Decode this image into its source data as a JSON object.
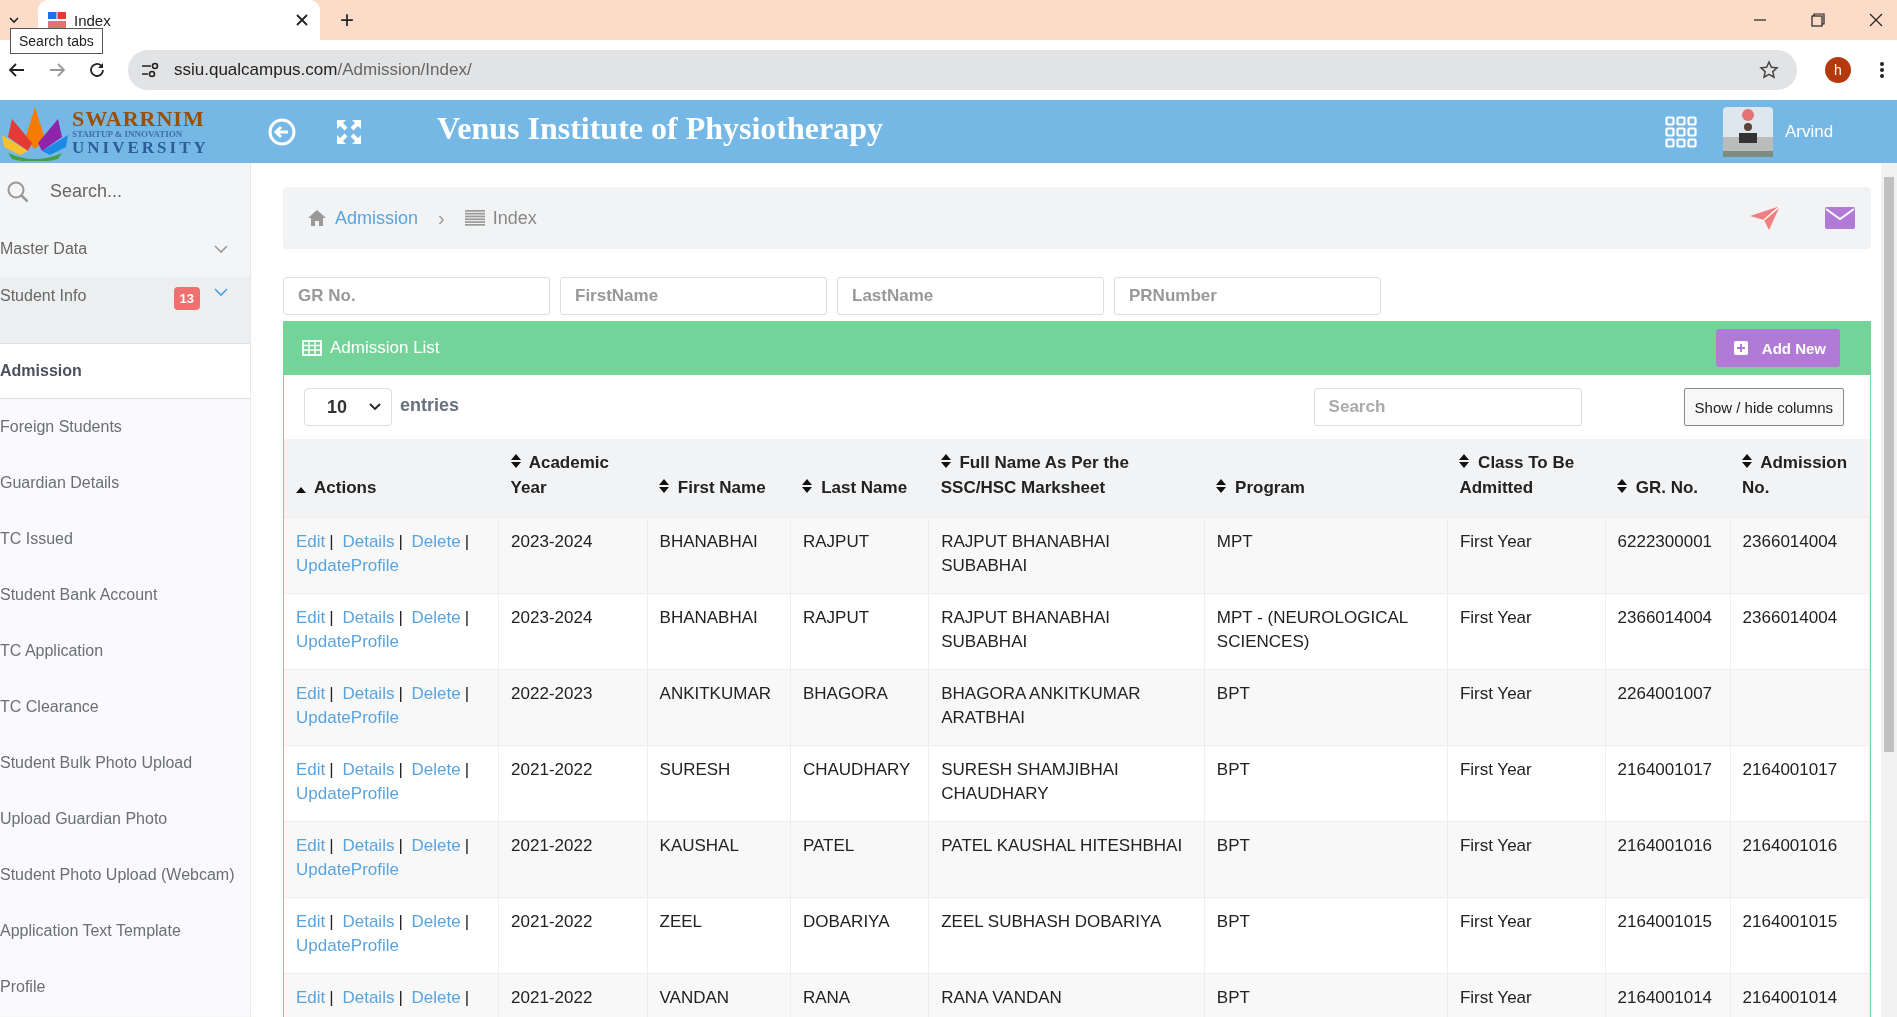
{
  "browser": {
    "tab_title": "Index",
    "tooltip": "Search tabs",
    "new_tab": "+",
    "url_host": "ssiu.qualcampus.com",
    "url_path": "/Admission/Index/",
    "profile_initial": "h"
  },
  "header": {
    "logo_lines": [
      "SWARRNIM",
      "STARTUP & INNOVATION",
      "UNIVERSITY"
    ],
    "title": "Venus Institute of Physiotherapy",
    "user": "Arvind"
  },
  "sidebar": {
    "search_placeholder": "Search...",
    "items": [
      {
        "label": "Master Data",
        "kind": "group",
        "expanded": false
      },
      {
        "label": "Student Info",
        "kind": "group",
        "expanded": true,
        "badge": "13"
      },
      {
        "label": "Admission",
        "kind": "link",
        "selected": true
      },
      {
        "label": "Foreign Students",
        "kind": "link",
        "selected": false
      },
      {
        "label": "Guardian Details",
        "kind": "link",
        "selected": false
      },
      {
        "label": "TC Issued",
        "kind": "link",
        "selected": false
      },
      {
        "label": "Student Bank Account",
        "kind": "link",
        "selected": false
      },
      {
        "label": "TC Application",
        "kind": "link",
        "selected": false
      },
      {
        "label": "TC Clearance",
        "kind": "link",
        "selected": false
      },
      {
        "label": "Student Bulk Photo Upload",
        "kind": "link",
        "selected": false
      },
      {
        "label": "Upload Guardian Photo",
        "kind": "link",
        "selected": false
      },
      {
        "label": "Student Photo Upload (Webcam)",
        "kind": "link",
        "selected": false
      },
      {
        "label": "Application Text Template",
        "kind": "link",
        "selected": false
      },
      {
        "label": "Profile",
        "kind": "link",
        "selected": false
      }
    ]
  },
  "breadcrumb": [
    {
      "label": "Admission",
      "kind": "link"
    },
    {
      "label": "Index",
      "kind": "current"
    }
  ],
  "breadcrumb_separator": "›",
  "filters": [
    {
      "placeholder": "GR No."
    },
    {
      "placeholder": "FirstName"
    },
    {
      "placeholder": "LastName"
    },
    {
      "placeholder": "PRNumber"
    }
  ],
  "panel": {
    "title": "Admission List",
    "add_button": "Add New",
    "page_size": "10",
    "entries_label": "entries",
    "search_placeholder": "Search",
    "columns_button": "Show / hide columns"
  },
  "table": {
    "actions_column": {
      "label": "Actions",
      "sorted": true
    },
    "columns": [
      {
        "label": "Academic Year",
        "sorted": false
      },
      {
        "label": "First Name",
        "sorted": false
      },
      {
        "label": "Last Name",
        "sorted": false
      },
      {
        "label": "Full Name As Per the SSC/HSC Marksheet",
        "sorted": false
      },
      {
        "label": "Program",
        "sorted": false
      },
      {
        "label": "Class To Be Admitted",
        "sorted": false
      },
      {
        "label": "GR. No.",
        "sorted": false
      },
      {
        "label": "Admission No.",
        "sorted": false
      }
    ],
    "rows": [
      {
        "actions": [
          {
            "label": "Edit",
            "sep": "|"
          },
          {
            "label": "Details",
            "sep": "|"
          },
          {
            "label": "Delete",
            "sep": "|"
          },
          {
            "label": "UpdateProfile"
          }
        ],
        "cells": [
          "2023-2024",
          "BHANABHAI",
          "RAJPUT",
          "RAJPUT BHANABHAI SUBABHAI",
          "MPT",
          "First Year",
          "6222300001",
          "2366014004"
        ]
      },
      {
        "actions": [
          {
            "label": "Edit",
            "sep": "|"
          },
          {
            "label": "Details",
            "sep": "|"
          },
          {
            "label": "Delete",
            "sep": "|"
          },
          {
            "label": "UpdateProfile"
          }
        ],
        "cells": [
          "2023-2024",
          "BHANABHAI",
          "RAJPUT",
          "RAJPUT BHANABHAI SUBABHAI",
          "MPT - (NEUROLOGICAL SCIENCES)",
          "First Year",
          "2366014004",
          "2366014004"
        ]
      },
      {
        "actions": [
          {
            "label": "Edit",
            "sep": "|"
          },
          {
            "label": "Details",
            "sep": "|"
          },
          {
            "label": "Delete",
            "sep": "|"
          },
          {
            "label": "UpdateProfile"
          }
        ],
        "cells": [
          "2022-2023",
          "ANKITKUMAR",
          "BHAGORA",
          "BHAGORA ANKITKUMAR ARATBHAI",
          "BPT",
          "First Year",
          "2264001007",
          ""
        ]
      },
      {
        "actions": [
          {
            "label": "Edit",
            "sep": "|"
          },
          {
            "label": "Details",
            "sep": "|"
          },
          {
            "label": "Delete",
            "sep": "|"
          },
          {
            "label": "UpdateProfile"
          }
        ],
        "cells": [
          "2021-2022",
          "SURESH",
          "CHAUDHARY",
          "SURESH SHAMJIBHAI CHAUDHARY",
          "BPT",
          "First Year",
          "2164001017",
          "2164001017"
        ]
      },
      {
        "actions": [
          {
            "label": "Edit",
            "sep": "|"
          },
          {
            "label": "Details",
            "sep": "|"
          },
          {
            "label": "Delete",
            "sep": "|"
          },
          {
            "label": "UpdateProfile"
          }
        ],
        "cells": [
          "2021-2022",
          "KAUSHAL",
          "PATEL",
          "PATEL KAUSHAL HITESHBHAI",
          "BPT",
          "First Year",
          "2164001016",
          "2164001016"
        ]
      },
      {
        "actions": [
          {
            "label": "Edit",
            "sep": "|"
          },
          {
            "label": "Details",
            "sep": "|"
          },
          {
            "label": "Delete",
            "sep": "|"
          },
          {
            "label": "UpdateProfile"
          }
        ],
        "cells": [
          "2021-2022",
          "ZEEL",
          "DOBARIYA",
          "ZEEL SUBHASH DOBARIYA",
          "BPT",
          "First Year",
          "2164001015",
          "2164001015"
        ]
      },
      {
        "actions": [
          {
            "label": "Edit",
            "sep": "|"
          },
          {
            "label": "Details",
            "sep": "|"
          },
          {
            "label": "Delete",
            "sep": "|"
          }
        ],
        "cells": [
          "2021-2022",
          "VANDAN",
          "RANA",
          "RANA VANDAN",
          "BPT",
          "First Year",
          "2164001014",
          "2164001014"
        ]
      }
    ]
  }
}
